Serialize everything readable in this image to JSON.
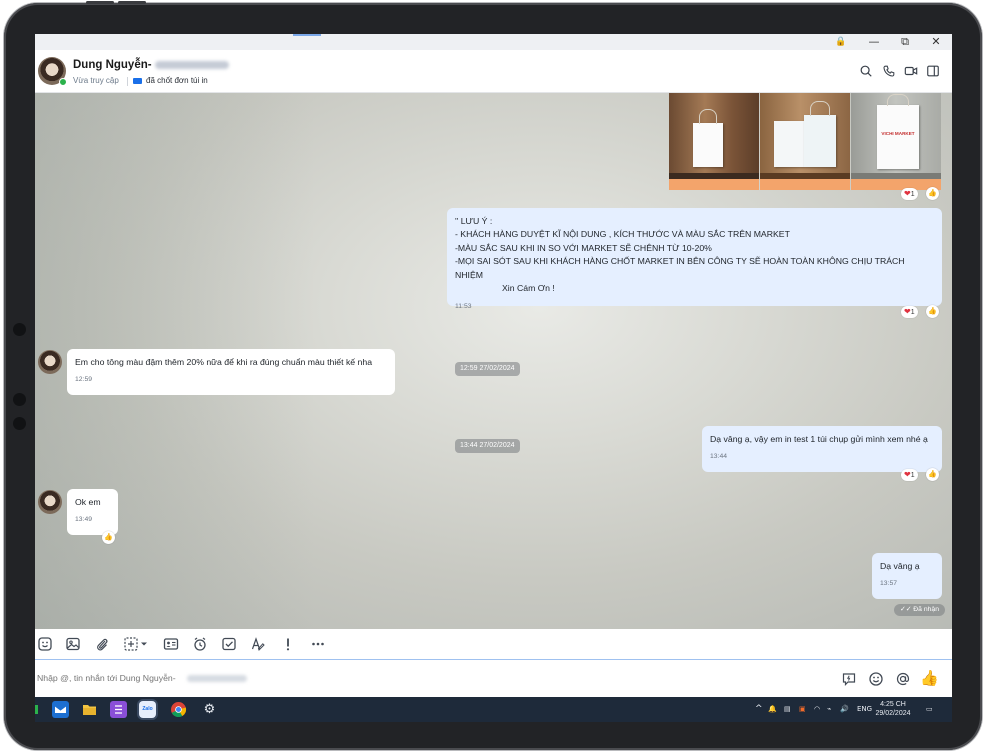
{
  "window": {
    "controls": {
      "lock": "🔒",
      "minimize": "—",
      "maximize": "⧉",
      "close": "✕"
    }
  },
  "header": {
    "contact_name": "Dung Nguyễn-",
    "status": "Vừa truy cập",
    "tag": "đã chốt đơn túi in",
    "icons": [
      "search-icon",
      "phone-icon",
      "video-icon",
      "sidebar-toggle-icon"
    ]
  },
  "product_images": [
    {
      "brand": "",
      "caption": ""
    },
    {
      "brand": "",
      "caption": ""
    },
    {
      "brand": "VICHI MARKET",
      "caption": ""
    }
  ],
  "messages": {
    "note": {
      "lines": [
        "'' LƯU Ý :",
        "- KHÁCH HÀNG DUYỆT KĨ NỘI DUNG , KÍCH THƯỚC  VÀ MÀU SẮC TRÊN MARKET",
        "-MÀU SẮC SAU KHI IN SO VỚI MARKET SẼ CHÊNH TỪ 10-20%",
        "-MỌI SAI SÓT SAU KHI KHÁCH HÀNG CHỐT MARKET IN BÊN CÔNG TY SẼ HOÀN TOÀN KHÔNG CHỊU TRÁCH NHIỆM",
        "Xin Cám Ơn !"
      ],
      "time": "11:53",
      "reaction_count": "1"
    },
    "images_reaction_count": "1",
    "date_chip_1": "12:59 27/02/2024",
    "incoming_1": {
      "text": "Em cho tông màu đậm thêm 20% nữa để khi ra đúng chuẩn màu thiết kế nha",
      "time": "12:59"
    },
    "date_chip_2": "13:44 27/02/2024",
    "outgoing_1": {
      "text": "Dạ vâng ạ, vậy em in test 1 túi chụp gửi mình xem nhé ạ",
      "time": "13:44",
      "reaction_count": "1"
    },
    "incoming_2": {
      "text": "Ok em",
      "time": "13:49"
    },
    "outgoing_2": {
      "text": "Dạ vâng ạ",
      "time": "13:57"
    },
    "delivery_status": "✓✓ Đã nhận"
  },
  "toolbar": {
    "icons": [
      "sticker-icon",
      "image-icon",
      "attachment-icon",
      "screenshot-icon",
      "contact-card-icon",
      "reminder-icon",
      "task-icon",
      "text-format-icon",
      "urgent-icon",
      "more-icon"
    ]
  },
  "composer": {
    "placeholder": "Nhập @, tin nhắn tới Dung Nguyễn-"
  },
  "taskbar": {
    "language": "ENG",
    "time": "4:25 CH",
    "date": "29/02/2024",
    "zalo_label": "Zalo"
  },
  "colors": {
    "outgoing_bubble": "#e5efff",
    "incoming_bubble": "#ffffff",
    "accent": "#1a6fe8",
    "heart": "#e03340",
    "taskbar": "#1e2a3a"
  }
}
